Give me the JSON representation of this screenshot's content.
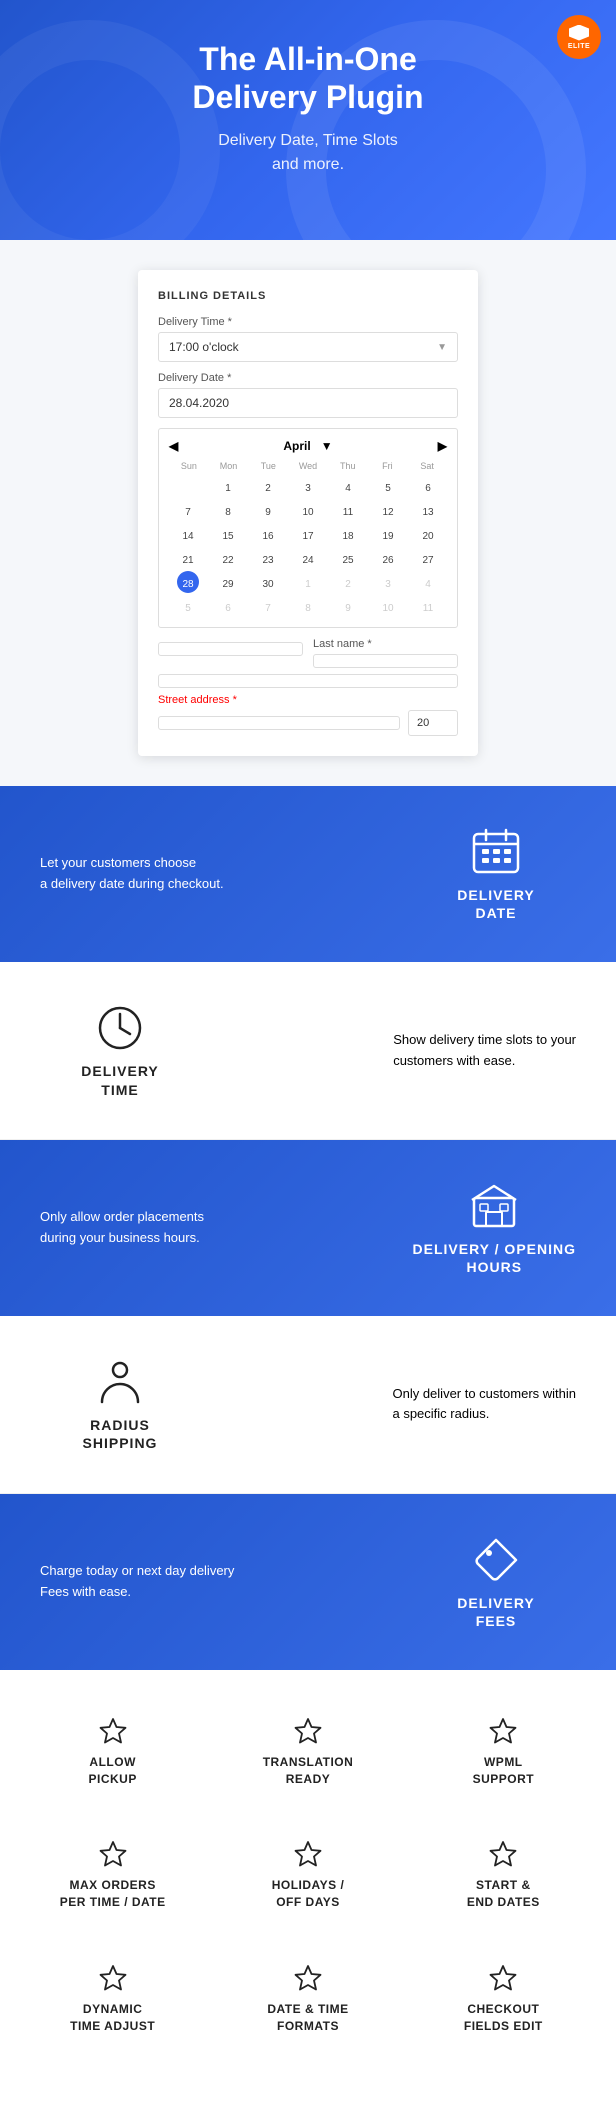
{
  "hero": {
    "badge_label": "ELITE",
    "title": "The All-in-One\nDelivery Plugin",
    "subtitle_line1": "Delivery Date, Time Slots",
    "subtitle_line2": "and more."
  },
  "billing": {
    "section_title": "BILLING DETAILS",
    "delivery_time_label": "Delivery Time *",
    "delivery_time_value": "17:00 o'clock",
    "delivery_date_label": "Delivery Date *",
    "delivery_date_value": "28.04.2020",
    "calendar_month": "April",
    "calendar_nav_prev": "◀",
    "calendar_nav_next": "▶",
    "days": [
      "Sun",
      "Mon",
      "Tue",
      "Wed",
      "Thu",
      "Fri",
      "Sat"
    ],
    "week1": [
      "",
      "1",
      "2",
      "3",
      "4",
      "5",
      "6"
    ],
    "week2": [
      "7",
      "8",
      "9",
      "10",
      "11",
      "12",
      "13"
    ],
    "week3": [
      "14",
      "15",
      "16",
      "17",
      "18",
      "19",
      "20"
    ],
    "week4": [
      "21",
      "22",
      "23",
      "24",
      "25",
      "26",
      "27"
    ],
    "week5": [
      "28",
      "29",
      "30",
      "1",
      "2",
      "3",
      "4"
    ],
    "week6": [
      "5",
      "6",
      "7",
      "8",
      "9",
      "10",
      "11"
    ],
    "last_name_label": "Last name *",
    "street_address_label": "Street address *"
  },
  "features": [
    {
      "id": "delivery-date",
      "description": "Let your customers choose\na delivery date during checkout.",
      "label": "DELIVERY\nDATE",
      "style": "blue",
      "icon": "calendar"
    },
    {
      "id": "delivery-time",
      "description": "Show delivery time slots to your\ncustomers with ease.",
      "label": "DELIVERY\nTIME",
      "style": "white",
      "icon": "clock"
    },
    {
      "id": "delivery-hours",
      "description": "Only allow order placements\nduring your business hours.",
      "label": "DELIVERY / OPENING\nHOURS",
      "style": "blue",
      "icon": "building"
    },
    {
      "id": "radius-shipping",
      "description": "Only deliver to customers within\na specific radius.",
      "label": "RADIUS\nSHIPPING",
      "style": "white",
      "icon": "person"
    },
    {
      "id": "delivery-fees",
      "description": "Charge today or next day delivery\nFees with ease.",
      "label": "DELIVERY\nFEES",
      "style": "blue",
      "icon": "tag"
    }
  ],
  "feature_grid": {
    "items": [
      {
        "id": "allow-pickup",
        "label": "ALLOW\nPICKUP"
      },
      {
        "id": "translation-ready",
        "label": "TRANSLATION\nREADY"
      },
      {
        "id": "wpml-support",
        "label": "WPML\nSUPPORT"
      },
      {
        "id": "max-orders",
        "label": "MAX ORDERS\nPER TIME / DATE"
      },
      {
        "id": "holidays",
        "label": "HOLIDAYS /\nOFF DAYS"
      },
      {
        "id": "start-end-dates",
        "label": "START &\nEND DATES"
      },
      {
        "id": "dynamic-time",
        "label": "DYNAMIC\nTIME ADJUST"
      },
      {
        "id": "date-time-formats",
        "label": "DATE & TIME\nFORMATS"
      },
      {
        "id": "checkout-fields",
        "label": "CHECKOUT\nFIELDS EDIT"
      }
    ]
  }
}
